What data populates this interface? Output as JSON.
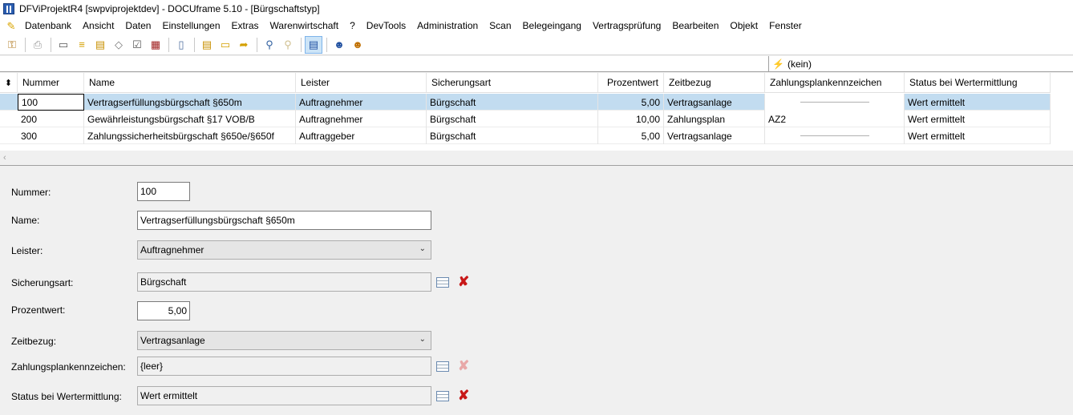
{
  "window": {
    "title": "DFViProjektR4 [swpviprojektdev] - DOCUframe 5.10 - [Bürgschaftstyp]"
  },
  "menu": [
    "Datenbank",
    "Ansicht",
    "Daten",
    "Einstellungen",
    "Extras",
    "Warenwirtschaft",
    "?",
    "DevTools",
    "Administration",
    "Scan",
    "Belegeingang",
    "Vertragsprüfung",
    "Bearbeiten",
    "Objekt",
    "Fenster"
  ],
  "toolbar": [
    "user-key-icon",
    "print-icon",
    "card-icon",
    "list-icon",
    "docs-icon",
    "tag-icon",
    "checklist-icon",
    "calendar-icon",
    "phone-icon",
    "note-icon",
    "folder-icon",
    "folder-arrow-icon",
    "search-icon",
    "search-disabled-icon",
    "form-view-icon",
    "user-run-icon",
    "user-run-2-icon"
  ],
  "filter": {
    "value": "(kein)"
  },
  "grid": {
    "columns": [
      "Nummer",
      "Name",
      "Leister",
      "Sicherungsart",
      "Prozentwert",
      "Zeitbezug",
      "Zahlungsplankennzeichen",
      "Status bei Wertermittlung"
    ],
    "rows": [
      {
        "nummer": "100",
        "name": "Vertragserfüllungsbürgschaft §650m",
        "leister": "Auftragnehmer",
        "sicherungsart": "Bürgschaft",
        "prozentwert": "5,00",
        "zeitbezug": "Vertragsanlage",
        "zahlungsplan": "",
        "status": "Wert ermittelt"
      },
      {
        "nummer": "200",
        "name": "Gewährleistungsbürgschaft §17 VOB/B",
        "leister": "Auftragnehmer",
        "sicherungsart": "Bürgschaft",
        "prozentwert": "10,00",
        "zeitbezug": "Zahlungsplan",
        "zahlungsplan": "AZ2",
        "status": "Wert ermittelt"
      },
      {
        "nummer": "300",
        "name": "Zahlungssicherheitsbürgschaft §650e/§650f",
        "leister": "Auftraggeber",
        "sicherungsart": "Bürgschaft",
        "prozentwert": "5,00",
        "zeitbezug": "Vertragsanlage",
        "zahlungsplan": "",
        "status": "Wert ermittelt"
      }
    ]
  },
  "form": {
    "nummer_label": "Nummer:",
    "nummer": "100",
    "name_label": "Name:",
    "name": "Vertragserfüllungsbürgschaft §650m",
    "leister_label": "Leister:",
    "leister": "Auftragnehmer",
    "sicherungsart_label": "Sicherungsart:",
    "sicherungsart": "Bürgschaft",
    "prozentwert_label": "Prozentwert:",
    "prozentwert": "5,00",
    "zeitbezug_label": "Zeitbezug:",
    "zeitbezug": "Vertragsanlage",
    "zahlungsplan_label": "Zahlungsplankennzeichen:",
    "zahlungsplan": "{leer}",
    "status_label": "Status bei Wertermittlung:",
    "status": "Wert ermittelt"
  }
}
